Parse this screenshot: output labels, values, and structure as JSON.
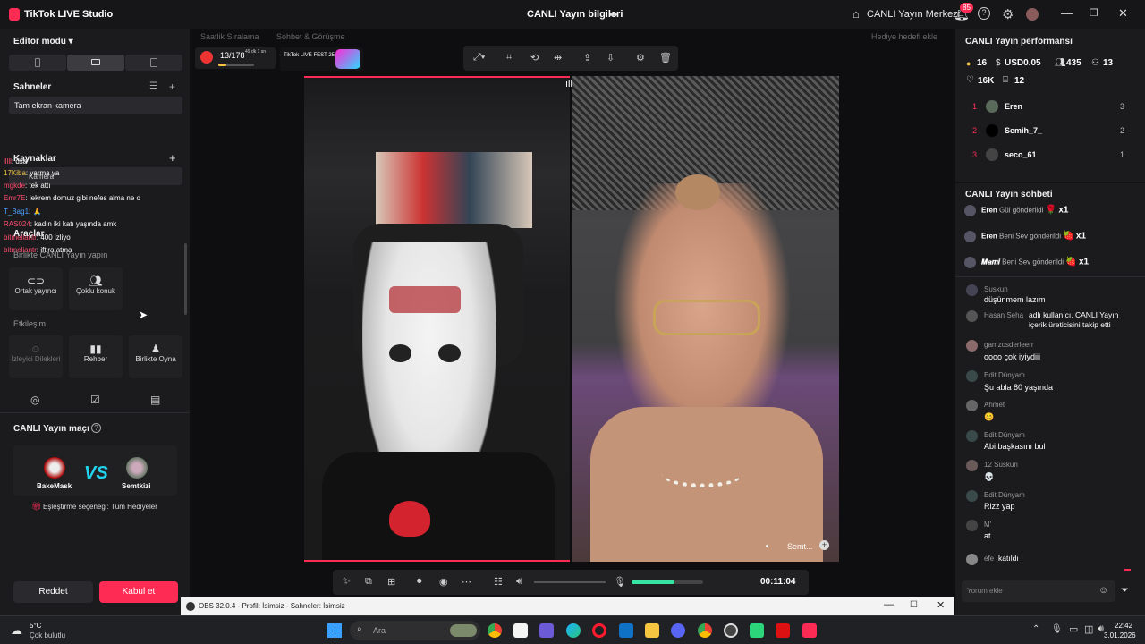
{
  "titlebar": {
    "app_title": "TikTok LIVE Studio",
    "center_title": "CANLI Yayın bilgileri",
    "center_link": "CANLI Yayın Merkezi",
    "notification_count": "85"
  },
  "left": {
    "editor_mode": "Editör modu ▾",
    "scenes_title": "Sahneler",
    "scene_item": "Tam ekran kamera",
    "sources_title": "Kaynaklar",
    "source_item": "Kamera",
    "tools_title": "Araçlar",
    "collab_title": "Birlikte CANLI Yayın yapın",
    "tools": [
      {
        "icon": "link-icon",
        "label": "Ortak yayıncı"
      },
      {
        "icon": "users-icon",
        "label": "Çoklu konuk"
      }
    ],
    "interaction_title": "Etkileşim",
    "interactions": [
      {
        "icon": "person-icon",
        "label": "İzleyici Dilekleri"
      },
      {
        "icon": "book-icon",
        "label": "Rehber"
      },
      {
        "icon": "game-icon",
        "label": "Birlikte Oyna"
      }
    ],
    "overlay_chat": [
      {
        "user": "lllll",
        "text": ": dsa",
        "color": "#ff4d6d"
      },
      {
        "user": "17Kiba",
        "text": ": yarma ya",
        "color": "#f4c542"
      },
      {
        "user": "mgkde",
        "text": ": tek attı",
        "color": "#ff4d6d"
      },
      {
        "user": "Emr7E",
        "text": ": lekrem domuz gibi nefes alma ne o",
        "color": "#ff4d6d"
      },
      {
        "user": "T_Bag1",
        "text": ": 🙏",
        "color": "#4da3ff"
      },
      {
        "user": "RAS024",
        "text": ": kadın iki katı yaşında amk",
        "color": "#ff4d6d"
      },
      {
        "user": "bitmeliantr",
        "text": ": 400 izliyo",
        "color": "#ff4d6d"
      },
      {
        "user": "bitmeliantr",
        "text": ": iftira atma",
        "color": "#ff4d6d"
      }
    ],
    "match_title": "CANLI Yayın maçı",
    "match_left": "BakeMask",
    "match_vs": "VS",
    "match_right": "Semtkizi",
    "match_option": "Eşleştirme seçeneği: Tüm Hediyeler",
    "reject": "Reddet",
    "accept": "Kabul et"
  },
  "center": {
    "hint_ranking": "Saatlik Sıralama",
    "hint_chat": "Sohbet & Görüşme",
    "hint_goal": "Hediye hedefi ekle",
    "rank_progress": "13/178",
    "rank_time": "49 dk 1 sn",
    "fest_label": "TikTok LIVE FEST 25",
    "right_video_label": "Semt...",
    "timer": "00:11:04",
    "volume_level": 0.6
  },
  "obs": {
    "title": "OBS 32.0.4 - Profil: İsimsiz - Sahneler: İsimsiz"
  },
  "right": {
    "perf_title": "CANLI Yayın performansı",
    "stats": [
      "16",
      "USD0.05",
      "435",
      "13",
      "16K",
      "12"
    ],
    "ranking": [
      {
        "rank": "1",
        "name": "Eren",
        "score": "3"
      },
      {
        "rank": "2",
        "name": "Semih_7_",
        "score": "2"
      },
      {
        "rank": "3",
        "name": "seco_61",
        "score": "1"
      }
    ],
    "chat_title": "CANLI Yayın sohbeti",
    "gifts": [
      {
        "user": "Eren",
        "text": "Gül gönderildi",
        "count": "x1"
      },
      {
        "user": "Eren",
        "text": "Beni Sev gönderildi",
        "count": "x1"
      },
      {
        "user": "𝑴𝒂𝒎𝒊",
        "text": "Beni Sev gönderildi",
        "count": "x1"
      }
    ],
    "messages": [
      {
        "name": "Suskun",
        "text": "düşünmem lazım"
      },
      {
        "name": "Hasan Seha",
        "text": "adlı kullanıcı, CANLI Yayın içerik üreticisini takip etti"
      },
      {
        "name": "gamzosderleerr",
        "text": "oooo çok iyiydiii"
      },
      {
        "name": "Edit Dünyam",
        "text": "Şu abla 80 yaşında"
      },
      {
        "name": "Ahmet",
        "text": "😊"
      },
      {
        "name": "Edit Dünyam",
        "text": "Abi başkasını bul"
      },
      {
        "name": "12 Suskun",
        "text": "💀"
      },
      {
        "name": "Edit Dünyam",
        "text": "Rizz yap"
      },
      {
        "name": "M'",
        "text": "at"
      },
      {
        "name": "efe",
        "text": "katıldı"
      }
    ],
    "comment_placeholder": "Yorum ekle"
  },
  "taskbar": {
    "weather_temp": "5°C",
    "weather_desc": "Çok bulutlu",
    "search": "Ara",
    "time": "22:42",
    "date": "3.01.2026"
  }
}
